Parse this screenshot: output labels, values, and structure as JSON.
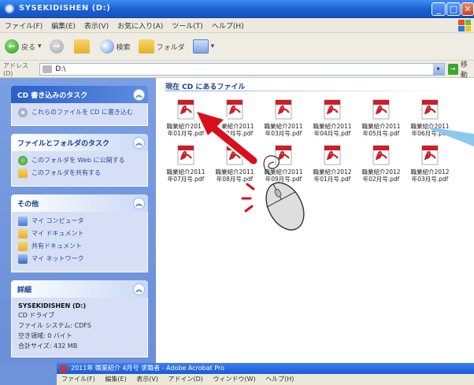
{
  "window": {
    "title": "SYSEKIDISHEN (D:)"
  },
  "menubar": {
    "items": [
      "ファイル(F)",
      "編集(E)",
      "表示(V)",
      "お気に入り(A)",
      "ツール(T)",
      "ヘルプ(H)"
    ]
  },
  "toolbar": {
    "back_label": "戻る",
    "search_label": "検索",
    "folders_label": "フォルダ"
  },
  "addressbar": {
    "label": "アドレス(D)",
    "value": "D:\\",
    "go_label": "移動"
  },
  "leftpane": {
    "cd_tasks": {
      "title": "CD 書き込みのタスク",
      "items": [
        "これらのファイルを CD に書き込む"
      ]
    },
    "file_tasks": {
      "title": "ファイルとフォルダのタスク",
      "items": [
        "このフォルダを Web に公開する",
        "このフォルダを共有する"
      ]
    },
    "other_places": {
      "title": "その他",
      "items": [
        "マイ コンピュータ",
        "マイ ドキュメント",
        "共有ドキュメント",
        "マイ ネットワーク"
      ]
    },
    "details": {
      "title": "詳細",
      "name": "SYSEKIDISHEN (D:)",
      "type": "CD ドライブ",
      "filesystem": "ファイル システム: CDFS",
      "free": "空き領域: 0 バイト",
      "total": "合計サイズ: 432 MB"
    }
  },
  "main": {
    "group_title": "現在 CD にあるファイル",
    "files": [
      "職業紹介2011年01月号.pdf",
      "職業紹介2011年02月号.pdf",
      "職業紹介2011年03月号.pdf",
      "職業紹介2011年04月号.pdf",
      "職業紹介2011年05月号.pdf",
      "職業紹介2011年06月号.pdf",
      "職業紹介2011年07月号.pdf",
      "職業紹介2011年08月号.pdf",
      "職業紹介2011年09月号.pdf",
      "職業紹介2012年01月号.pdf",
      "職業紹介2012年02月号.pdf",
      "職業紹介2012年03月号.pdf"
    ]
  },
  "acrobat": {
    "title": "2011年 職業紹介 4月号 求職者 - Adobe Acrobat Pro",
    "menu": [
      "ファイル(F)",
      "編集(E)",
      "表示(V)",
      "アドイン(D)",
      "ウィンドウ(W)",
      "ヘルプ(H)"
    ]
  },
  "colors": {
    "titlebar": "#1a5fd0",
    "taskpane": "#6b8fd8",
    "pdf_red": "#c8202a",
    "pointer_arrow": "#d8101c"
  }
}
